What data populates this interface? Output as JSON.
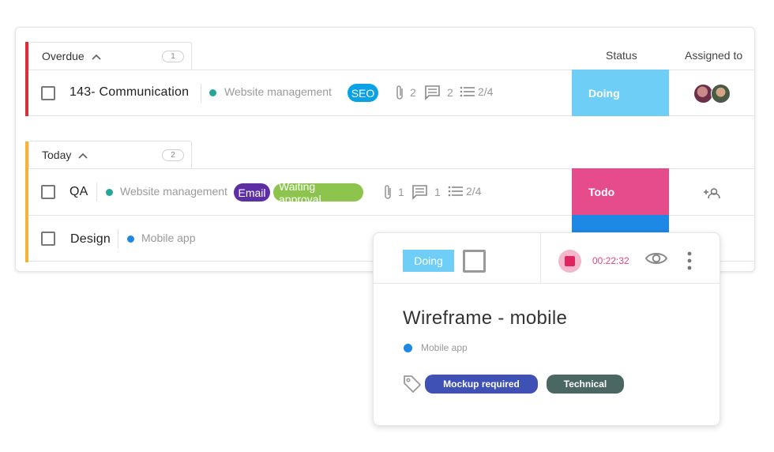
{
  "columns": {
    "status": "Status",
    "assigned": "Assigned to"
  },
  "groups": [
    {
      "label": "Overdue",
      "count": "1",
      "accent": "#d92f3a",
      "tasks": [
        {
          "name": "143- Communication",
          "project": "Website management",
          "project_color": "#26a69a",
          "tags": [
            {
              "label": "SEO",
              "color": "#0aa2e4"
            }
          ],
          "attachments": "2",
          "comments": "2",
          "checklist": "2/4",
          "status": "Doing",
          "status_color": "#6ecef6"
        }
      ]
    },
    {
      "label": "Today",
      "count": "2",
      "accent": "#f3b43d",
      "tasks": [
        {
          "name": "QA",
          "project": "Website management",
          "project_color": "#26a69a",
          "tags": [
            {
              "label": "Email",
              "color": "#5d2fa5"
            },
            {
              "label": "Waiting approval",
              "color": "#8dc44d"
            }
          ],
          "attachments": "1",
          "comments": "1",
          "checklist": "2/4",
          "status": "Todo",
          "status_color": "#e64c8b"
        },
        {
          "name": "Design",
          "project": "Mobile app",
          "project_color": "#1e88e5",
          "status_color": "#1e88e5"
        }
      ]
    }
  ],
  "popup": {
    "status": "Doing",
    "timer": "00:22:32",
    "title": "Wireframe - mobile",
    "project": "Mobile app",
    "project_color": "#1e88e5",
    "tags": [
      {
        "label": "Mockup required",
        "color": "#3f51b5"
      },
      {
        "label": "Technical",
        "color": "#4b6763"
      }
    ]
  }
}
